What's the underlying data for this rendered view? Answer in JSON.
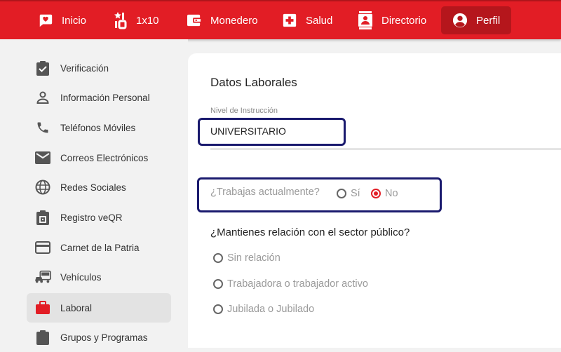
{
  "topnav": {
    "items": [
      {
        "label": "Inicio",
        "icon": "chat-heart-icon"
      },
      {
        "label": "1x10",
        "icon": "star-ten-icon"
      },
      {
        "label": "Monedero",
        "icon": "wallet-icon"
      },
      {
        "label": "Salud",
        "icon": "medical-cross-icon"
      },
      {
        "label": "Directorio",
        "icon": "contact-book-icon"
      },
      {
        "label": "Perfil",
        "icon": "account-circle-icon"
      }
    ],
    "active": "Perfil",
    "color": "#e21d25"
  },
  "sidebar": {
    "items": [
      {
        "label": "Verificación",
        "icon": "clipboard-check-icon"
      },
      {
        "label": "Información Personal",
        "icon": "person-icon"
      },
      {
        "label": "Teléfonos Móviles",
        "icon": "phone-icon"
      },
      {
        "label": "Correos Electrónicos",
        "icon": "mail-icon"
      },
      {
        "label": "Redes Sociales",
        "icon": "globe-icon"
      },
      {
        "label": "Registro veQR",
        "icon": "qr-clipboard-icon"
      },
      {
        "label": "Carnet de la Patria",
        "icon": "card-icon"
      },
      {
        "label": "Vehículos",
        "icon": "vehicles-icon"
      },
      {
        "label": "Laboral",
        "icon": "briefcase-icon"
      },
      {
        "label": "Grupos y Programas",
        "icon": "group-icon"
      }
    ],
    "active": "Laboral"
  },
  "main": {
    "title": "Datos Laborales",
    "instruction_label": "Nivel de Instrucción",
    "instruction_value": "UNIVERSITARIO",
    "works_question": "¿Trabajas actualmente?",
    "works_options": [
      "Sí",
      "No"
    ],
    "works_selected": "No",
    "public_question": "¿Mantienes relación con el sector público?",
    "public_options": [
      "Sin relación",
      "Trabajadora o trabajador activo",
      "Jubilada o Jubilado"
    ]
  }
}
